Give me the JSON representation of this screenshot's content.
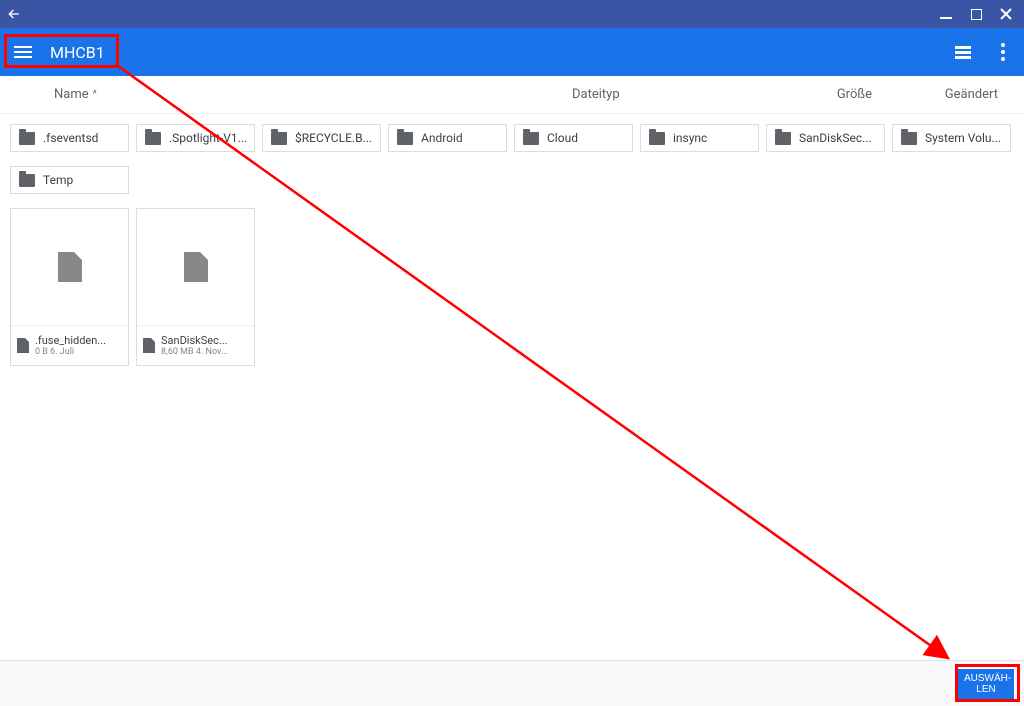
{
  "header": {
    "location": "MHCB1"
  },
  "columns": {
    "name": "Name",
    "type": "Dateityp",
    "size": "Größe",
    "changed": "Geändert",
    "sort_indicator": "^"
  },
  "folders": [
    {
      "label": ".fseventsd"
    },
    {
      "label": ".Spotlight-V1..."
    },
    {
      "label": "$RECYCLE.B..."
    },
    {
      "label": "Android"
    },
    {
      "label": "Cloud"
    },
    {
      "label": "insync"
    },
    {
      "label": "SanDiskSec..."
    },
    {
      "label": "System Volu..."
    },
    {
      "label": "Temp"
    }
  ],
  "files": [
    {
      "name": ".fuse_hidden...",
      "meta": "0 B 6. Juli"
    },
    {
      "name": "SanDiskSec...",
      "meta": "8,60 MB 4. Nov..."
    }
  ],
  "footer": {
    "select_button": "AUSWÄH-\nLEN"
  }
}
